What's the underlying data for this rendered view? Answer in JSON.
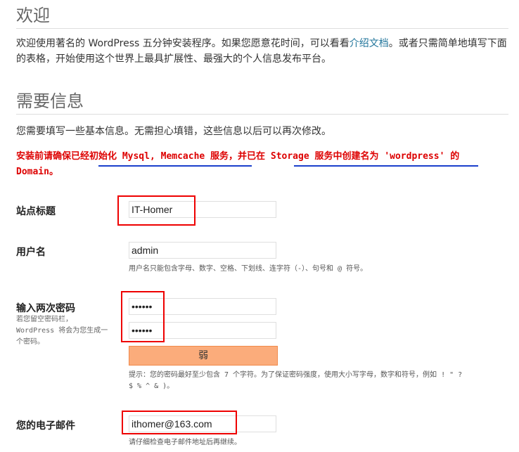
{
  "welcome": {
    "title": "欢迎",
    "line1_before": "欢迎使用著名的 WordPress 五分钟安装程序。如果您愿意花时间，可以看看",
    "link": "介绍文档",
    "line1_after": "。或者只需简单地填写下面",
    "line2": "的表格，开始使用这个世界上最具扩展性、最强大的个人信息发布平台。"
  },
  "info": {
    "title": "需要信息",
    "desc": "您需要填写一些基本信息。无需担心填错，这些信息以后可以再次修改。",
    "warning_line1": "安装前请确保已经初始化 Mysql, Memcache 服务，并已在 Storage 服务中创建名为 'wordpress' 的",
    "warning_line2": "Domain。"
  },
  "form": {
    "site_title": {
      "label": "站点标题",
      "value": "IT-Homer"
    },
    "username": {
      "label": "用户名",
      "value": "admin",
      "hint": "用户名只能包含字母、数字、空格、下划线、连字符（-）、句号和 @ 符号。"
    },
    "password": {
      "label": "输入两次密码",
      "sub1": "若您留空密码栏，",
      "sub2": "WordPress 将会为您生成一",
      "sub3": "个密码。",
      "value1": "••••••",
      "value2": "••••••",
      "strength": "弱",
      "hint1": "提示：您的密码最好至少包含 7 个字符。为了保证密码强度，使用大小写字母，数字和符号，例如 ! \" ?",
      "hint2": "$ % ^ & )。"
    },
    "email": {
      "label": "您的电子邮件",
      "value": "ithomer@163.com",
      "hint": "请仔细检查电子邮件地址后再继续。"
    }
  },
  "colors": {
    "warning": "#dd0000",
    "annotation_box": "#ee0000",
    "underline": "#1a3fcc",
    "strength_meter": "#fbac7b"
  }
}
